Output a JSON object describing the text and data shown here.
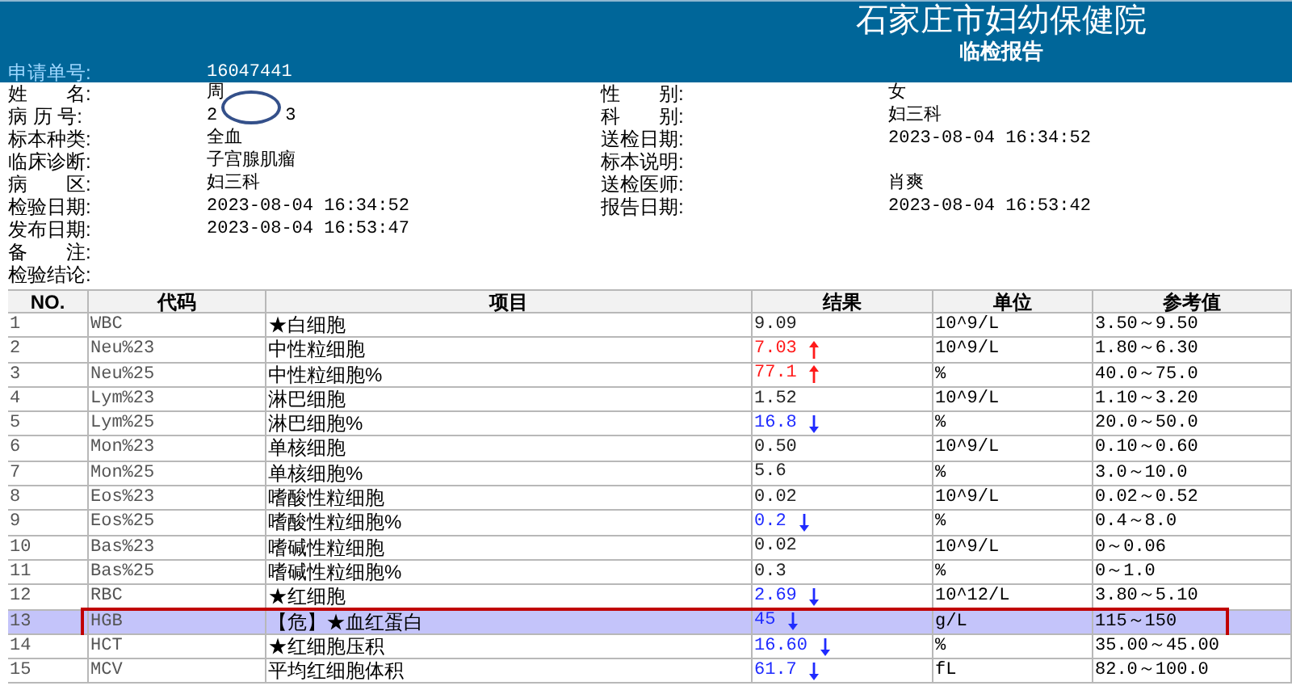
{
  "header": {
    "title": "石家庄市妇幼保健院",
    "subtitle": "临检报告",
    "request_label": "申请单号:",
    "request_number": "16047441"
  },
  "info_left": [
    {
      "label": "姓　　名:",
      "value": "周"
    },
    {
      "label": "病 历 号:",
      "value": "2",
      "value_after": "3"
    },
    {
      "label": "标本种类:",
      "value": "全血"
    },
    {
      "label": "临床诊断:",
      "value": "子宫腺肌瘤"
    },
    {
      "label": "病　　区:",
      "value": "妇三科"
    },
    {
      "label": "检验日期:",
      "value": "2023-08-04 16:34:52"
    },
    {
      "label": "发布日期:",
      "value": "2023-08-04 16:53:47"
    },
    {
      "label": "备　　注:"
    },
    {
      "label": "检验结论:"
    }
  ],
  "info_right": [
    {
      "label": "性　　别:",
      "value": "女"
    },
    {
      "label": "科　　别:",
      "value": "妇三科"
    },
    {
      "label": "送检日期:",
      "value": "2023-08-04 16:34:52"
    },
    {
      "label": "标本说明:"
    },
    {
      "label": "送检医师:",
      "value": "肖爽"
    },
    {
      "label": "报告日期:",
      "value": "2023-08-04 16:53:42"
    }
  ],
  "table": {
    "columns": [
      "NO.",
      "代码",
      "项目",
      "结果",
      "单位",
      "参考值"
    ],
    "rows": [
      {
        "no": "1",
        "code": "WBC",
        "item": "★白细胞",
        "result": "9.09",
        "high": false,
        "low": false,
        "unit": "10^9/L",
        "reference": "3.50～9.50",
        "selected": false,
        "circled": false
      },
      {
        "no": "2",
        "code": "Neu%23",
        "item": "中性粒细胞",
        "result": "7.03",
        "high": true,
        "low": false,
        "unit": "10^9/L",
        "reference": "1.80～6.30",
        "selected": false,
        "circled": false
      },
      {
        "no": "3",
        "code": "Neu%25",
        "item": "中性粒细胞%",
        "result": "77.1",
        "high": true,
        "low": false,
        "unit": "%",
        "reference": "40.0～75.0",
        "selected": false,
        "circled": false
      },
      {
        "no": "4",
        "code": "Lym%23",
        "item": "淋巴细胞",
        "result": "1.52",
        "high": false,
        "low": false,
        "unit": "10^9/L",
        "reference": "1.10～3.20",
        "selected": false,
        "circled": false
      },
      {
        "no": "5",
        "code": "Lym%25",
        "item": "淋巴细胞%",
        "result": "16.8",
        "high": false,
        "low": true,
        "unit": "%",
        "reference": "20.0～50.0",
        "selected": false,
        "circled": false
      },
      {
        "no": "6",
        "code": "Mon%23",
        "item": "单核细胞",
        "result": "0.50",
        "high": false,
        "low": false,
        "unit": "10^9/L",
        "reference": "0.10～0.60",
        "selected": false,
        "circled": false
      },
      {
        "no": "7",
        "code": "Mon%25",
        "item": "单核细胞%",
        "result": "5.6",
        "high": false,
        "low": false,
        "unit": "%",
        "reference": "3.0～10.0",
        "selected": false,
        "circled": false
      },
      {
        "no": "8",
        "code": "Eos%23",
        "item": "嗜酸性粒细胞",
        "result": "0.02",
        "high": false,
        "low": false,
        "unit": "10^9/L",
        "reference": "0.02～0.52",
        "selected": false,
        "circled": false
      },
      {
        "no": "9",
        "code": "Eos%25",
        "item": "嗜酸性粒细胞%",
        "result": "0.2",
        "high": false,
        "low": true,
        "unit": "%",
        "reference": "0.4～8.0",
        "selected": false,
        "circled": false
      },
      {
        "no": "10",
        "code": "Bas%23",
        "item": "嗜碱性粒细胞",
        "result": "0.02",
        "high": false,
        "low": false,
        "unit": "10^9/L",
        "reference": "0～0.06",
        "selected": false,
        "circled": false
      },
      {
        "no": "11",
        "code": "Bas%25",
        "item": "嗜碱性粒细胞%",
        "result": "0.3",
        "high": false,
        "low": false,
        "unit": "%",
        "reference": "0～1.0",
        "selected": false,
        "circled": false
      },
      {
        "no": "12",
        "code": "RBC",
        "item": "★红细胞",
        "result": "2.69",
        "high": false,
        "low": true,
        "unit": "10^12/L",
        "reference": "3.80～5.10",
        "selected": false,
        "circled": false
      },
      {
        "no": "13",
        "code": "HGB",
        "item": "【危】★血红蛋白",
        "result": "45",
        "high": false,
        "low": true,
        "unit": "g/L",
        "reference": "115～150",
        "selected": true,
        "circled": true
      },
      {
        "no": "14",
        "code": "HCT",
        "item": "★红细胞压积",
        "result": "16.60",
        "high": false,
        "low": true,
        "unit": "%",
        "reference": "35.00～45.00",
        "selected": false,
        "circled": false
      },
      {
        "no": "15",
        "code": "MCV",
        "item": "平均红细胞体积",
        "result": "61.7",
        "high": false,
        "low": true,
        "unit": "fL",
        "reference": "82.0～100.0",
        "selected": false,
        "circled": false
      }
    ]
  }
}
